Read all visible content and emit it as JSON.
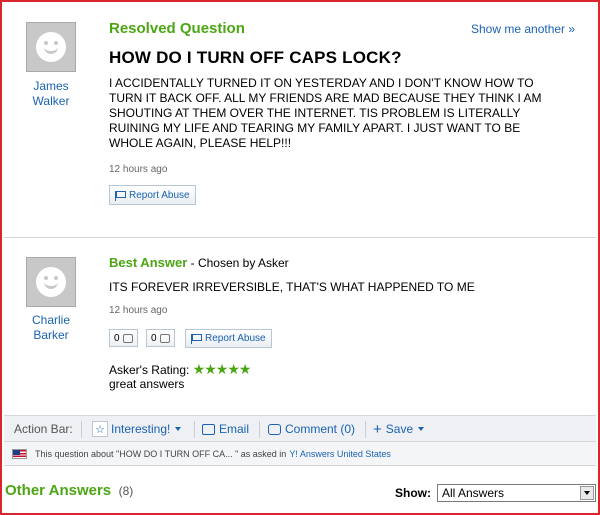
{
  "question": {
    "status_label": "Resolved Question",
    "show_another": "Show me another »",
    "author": "James\nWalker",
    "title": "HOW DO I TURN OFF CAPS LOCK?",
    "body": "I ACCIDENTALLY TURNED IT ON YESTERDAY AND I DON'T KNOW HOW TO TURN IT BACK OFF. ALL MY FRIENDS ARE MAD BECAUSE THEY THINK I AM SHOUTING AT THEM OVER THE INTERNET. TIS PROBLEM IS LITERALLY RUINING MY LIFE AND TEARING MY FAMILY APART. I JUST WANT TO BE WHOLE AGAIN, PLEASE HELP!!!",
    "time": "12 hours ago",
    "report": "Report Abuse"
  },
  "best_answer": {
    "label": "Best Answer",
    "chosen_by": " - Chosen by Asker",
    "author": "Charlie\nBarker",
    "body": "ITS FOREVER IRREVERSIBLE, THAT'S WHAT HAPPENED TO ME",
    "time": "12 hours ago",
    "thumbs_up": "0",
    "thumbs_down": "0",
    "report": "Report Abuse",
    "rating_label": "Asker's Rating:",
    "rating_stars": "★★★★★",
    "rating_value": 5,
    "rating_comment": "great answers"
  },
  "action_bar": {
    "label": "Action Bar:",
    "interesting": "Interesting!",
    "email": "Email",
    "comment": "Comment (0)",
    "save": "Save"
  },
  "notice": {
    "text_prefix": "This question about \"HOW DO I TURN OFF CA... \" as asked in ",
    "link": "Y! Answers United States"
  },
  "other_answers": {
    "label": "Other Answers",
    "count": "(8)",
    "show_label": "Show:",
    "show_value": "All Answers"
  },
  "colors": {
    "accent_green": "#4ca614",
    "link_blue": "#1b62b4",
    "frame_red": "#d9262c"
  }
}
